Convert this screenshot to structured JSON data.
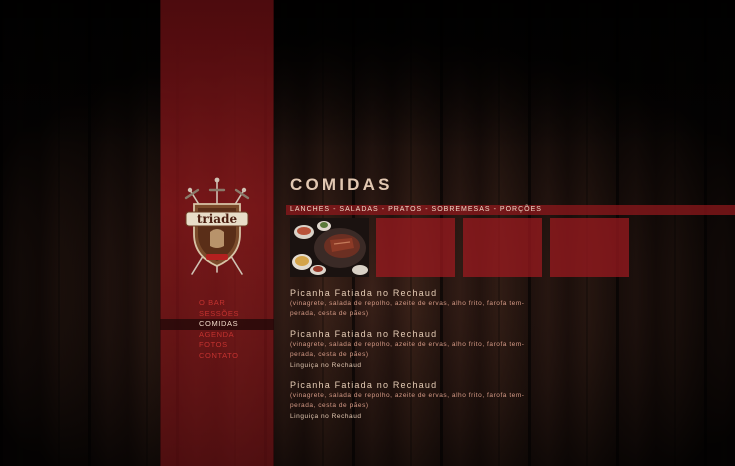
{
  "nav": {
    "items": [
      {
        "label": "O Bar",
        "active": false
      },
      {
        "label": "Sessões",
        "active": false
      },
      {
        "label": "Comidas",
        "active": true
      },
      {
        "label": "Agenda",
        "active": false
      },
      {
        "label": "Fotos",
        "active": false
      },
      {
        "label": "Contato",
        "active": false
      }
    ]
  },
  "logo": {
    "text": "triade"
  },
  "page": {
    "title": "COMIDAS"
  },
  "categories": {
    "items": [
      "LANCHES",
      "SALADAS",
      "PRATOS",
      "SOBREMESAS",
      "PORÇÕES"
    ],
    "separator": "-"
  },
  "dishes": [
    {
      "name": "Picanha Fatiada no Rechaud",
      "desc_line1": "(vinagrete, salada de repolho, azeite de ervas, alho frito, farofa tem-",
      "desc_line2": "perada, cesta de pães)",
      "extra": ""
    },
    {
      "name": "Picanha Fatiada no Rechaud",
      "desc_line1": "(vinagrete, salada de repolho, azeite de ervas, alho frito, farofa tem-",
      "desc_line2": "perada, cesta de pães)",
      "extra": "Linguiça no Rechaud"
    },
    {
      "name": "Picanha Fatiada no Rechaud",
      "desc_line1": "(vinagrete, salada de repolho, azeite de ervas, alho frito, farofa tem-",
      "desc_line2": "perada, cesta de pães)",
      "extra": "Linguiça no Rechaud"
    }
  ],
  "colors": {
    "accent_red": "#96181c",
    "nav_text": "#c3322f",
    "title_text": "#e2c8b2"
  }
}
